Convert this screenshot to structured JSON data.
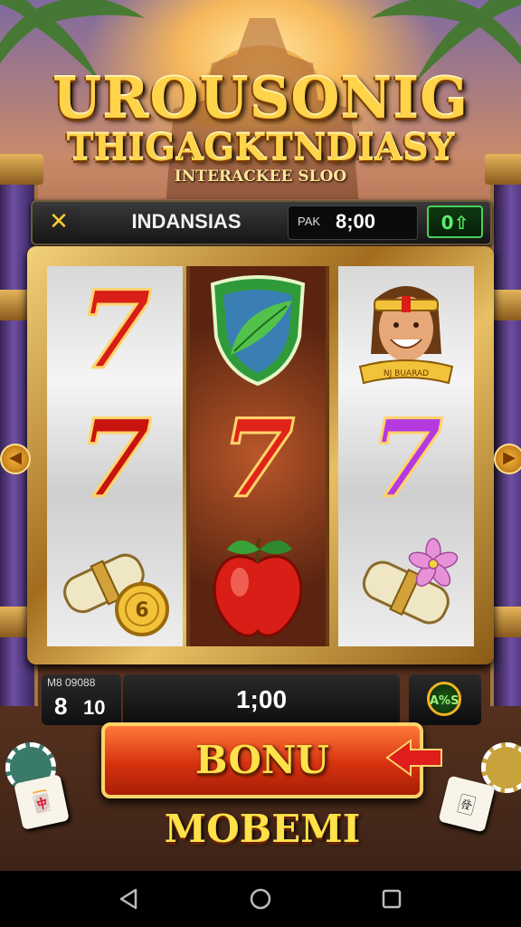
{
  "header": {
    "title_line1": "UROUSONIG",
    "title_line2": "THIGAGKTNDIASY",
    "subtitle": "INTERACKEE SLOO"
  },
  "info_bar": {
    "close_label": "✕",
    "panel_name": "INDANSIAS",
    "credit_label": "PAK",
    "credit_value": "8;00",
    "win_label": "0"
  },
  "reels": [
    [
      "seven-red",
      "shield-leaf",
      "hero-portrait"
    ],
    [
      "seven-red",
      "seven-red",
      "seven-purple"
    ],
    [
      "scroll-coin",
      "apple",
      "scroll-flower"
    ]
  ],
  "portrait_ribbon": "NJ BUARAD",
  "coin_text": "6",
  "bottom_bar": {
    "lines_label": "M8 09088",
    "lines_value_1": "8",
    "lines_value_2": "10",
    "bet_value": "1;00",
    "auto_label": "A%S"
  },
  "bonus_button": "BONU MOBEMI",
  "colors": {
    "gold": "#ffd34a",
    "red_seven": "#d81e16",
    "purple_seven": "#b43ae0",
    "bonus_red": "#d6320e",
    "win_green": "#5cf06a"
  },
  "nav": {
    "back_icon": "back-triangle-icon",
    "home_icon": "home-circle-icon",
    "recents_icon": "recents-square-icon"
  }
}
